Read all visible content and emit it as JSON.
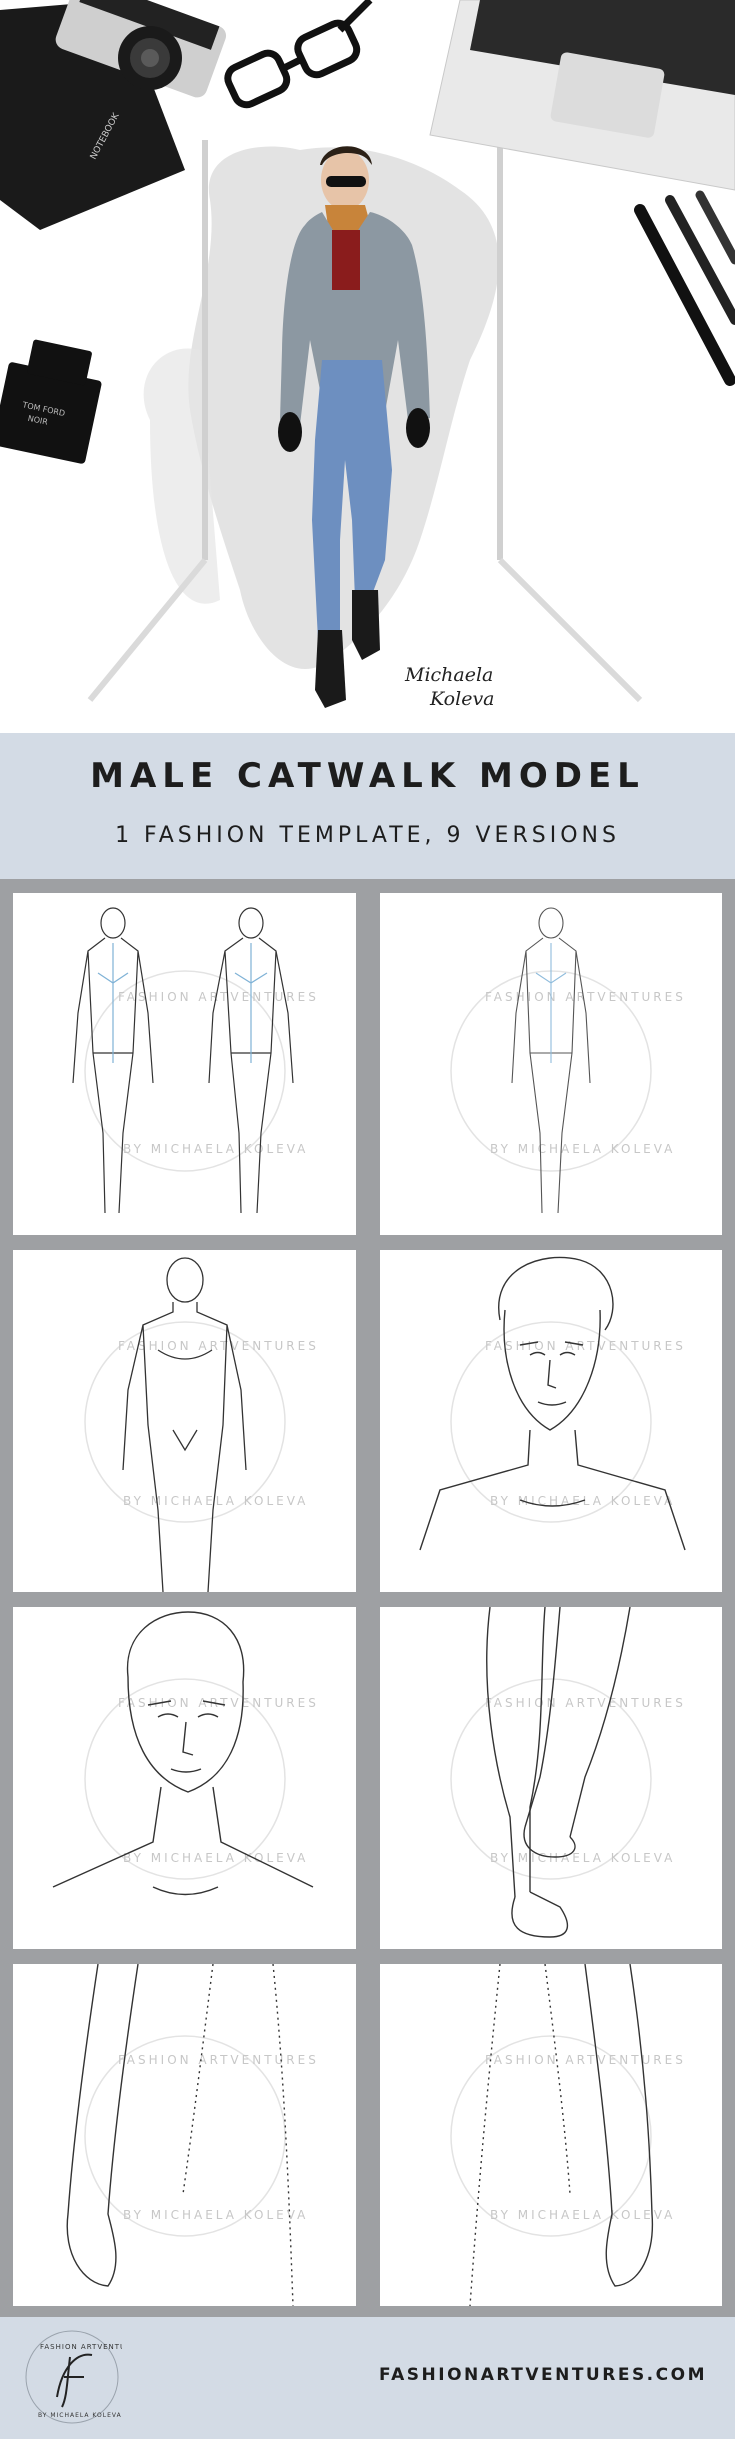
{
  "hero": {
    "signature_line1": "Michaela",
    "signature_line2": "Koleva",
    "book_label": "NOTEBOOK",
    "perfume_label_line1": "TOM FORD",
    "perfume_label_line2": "NOIR"
  },
  "title": {
    "heading": "MALE CATWALK MODEL",
    "subheading": "1 FASHION TEMPLATE, 9 VERSIONS"
  },
  "watermark": {
    "top_text": "FASHION ARTVENTURES",
    "bottom_text": "BY MICHAELA KOLEVA"
  },
  "panels": [
    {
      "name": "two-full-body-croquis"
    },
    {
      "name": "single-full-body-croquis"
    },
    {
      "name": "upper-body-croquis"
    },
    {
      "name": "head-and-shoulders-with-hair"
    },
    {
      "name": "bald-head-and-neck"
    },
    {
      "name": "legs-and-feet"
    },
    {
      "name": "hip-and-arm-left"
    },
    {
      "name": "hip-and-arm-right"
    }
  ],
  "footer": {
    "logo_top": "FASHION ARTVENTURES",
    "logo_bottom": "BY MICHAELA KOLEVA",
    "url": "FASHIONARTVENTURES.COM"
  }
}
